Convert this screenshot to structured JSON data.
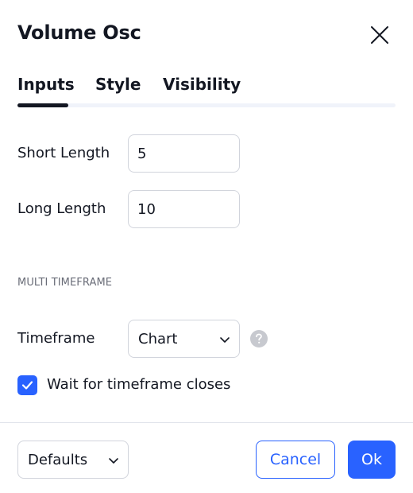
{
  "dialog": {
    "title": "Volume Osc"
  },
  "tabs": [
    {
      "label": "Inputs",
      "active": true
    },
    {
      "label": "Style",
      "active": false
    },
    {
      "label": "Visibility",
      "active": false
    }
  ],
  "inputs": {
    "short_length": {
      "label": "Short Length",
      "value": "5"
    },
    "long_length": {
      "label": "Long Length",
      "value": "10"
    },
    "section_title": "MULTI TIMEFRAME",
    "timeframe": {
      "label": "Timeframe",
      "selected": "Chart",
      "help_icon": "question-circle-icon"
    },
    "wait_closes": {
      "label": "Wait for timeframe closes",
      "checked": true
    }
  },
  "footer": {
    "defaults_label": "Defaults",
    "cancel_label": "Cancel",
    "ok_label": "Ok"
  },
  "colors": {
    "accent": "#2962ff",
    "text": "#131722",
    "muted": "#6a6d78",
    "border": "#d1d4dc"
  }
}
